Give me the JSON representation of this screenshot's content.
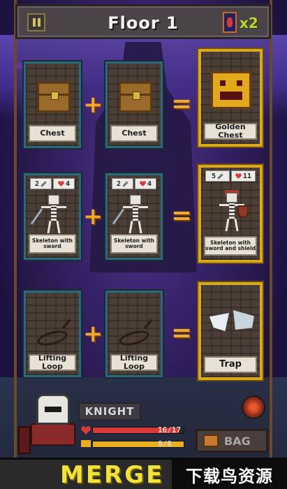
{
  "header": {
    "floor_title": "Floor 1",
    "multiplier": "x2"
  },
  "recipes": [
    {
      "inputs": [
        {
          "name": "Chest"
        },
        {
          "name": "Chest"
        }
      ],
      "plus": "+",
      "equals": "=",
      "result": {
        "name": "Golden Chest"
      }
    },
    {
      "inputs": [
        {
          "name": "Skeleton with sword",
          "attack": "2",
          "health": "4"
        },
        {
          "name": "Skeleton with sword",
          "attack": "2",
          "health": "4"
        }
      ],
      "plus": "+",
      "equals": "=",
      "result": {
        "name": "Skeleton with sword and shield",
        "attack": "5",
        "health": "11"
      }
    },
    {
      "inputs": [
        {
          "name": "Lifting Loop"
        },
        {
          "name": "Lifting Loop"
        }
      ],
      "plus": "+",
      "equals": "=",
      "result": {
        "name": "Trap"
      }
    }
  ],
  "hero": {
    "name": "KNIGHT",
    "hp": {
      "current": 16,
      "max": 17,
      "text": "16/17"
    },
    "xp": {
      "current": 8,
      "max": 8,
      "text": "8/8"
    }
  },
  "bag_label": "BAG",
  "banner_text": "MERGE CA",
  "watermark": "下载鸟资源",
  "colors": {
    "accent_orange": "#f0a830",
    "card_border": "#2a6a80",
    "gold_border": "#d8a820",
    "hp_bar": "#d83a3a",
    "xp_bar": "#e8b020",
    "banner_text": "#f2e23a"
  }
}
